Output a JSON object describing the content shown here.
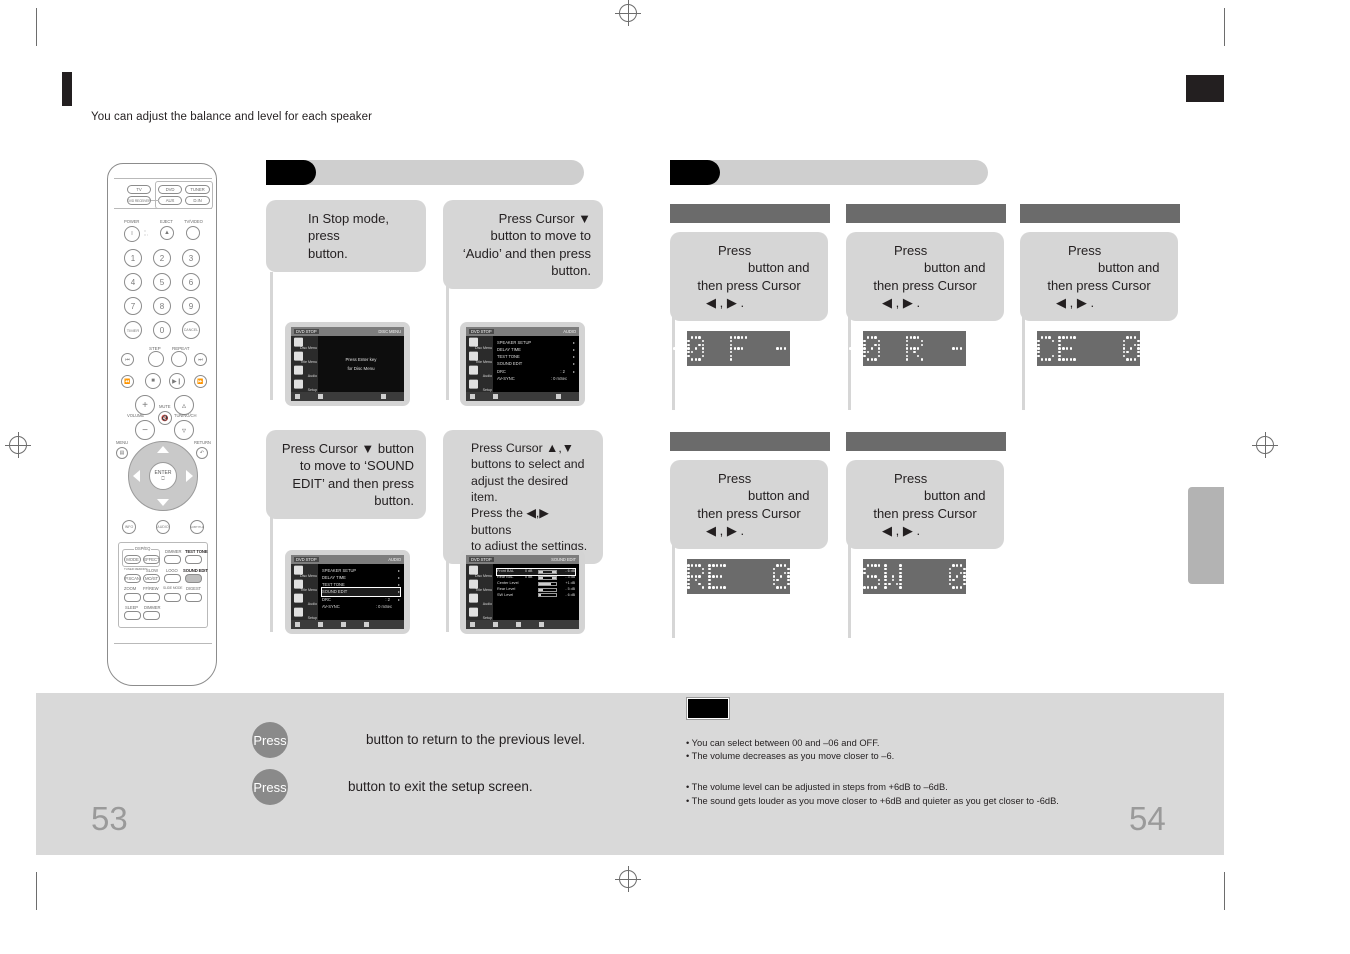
{
  "header": {
    "subtitle": "You can adjust the balance and level for each speaker"
  },
  "pages": {
    "left": "53",
    "right": "54"
  },
  "remote": {
    "source_buttons": [
      "TV",
      "DVD",
      "TUNER",
      "DVD RECEIVER",
      "AUX",
      "D.IN"
    ],
    "power_label": "POWER",
    "eject_label": "EJECT",
    "tvvideo_label": "TV/VIDEO",
    "numbers": [
      "1",
      "2",
      "3",
      "4",
      "5",
      "6",
      "7",
      "8",
      "9",
      "0"
    ],
    "timer_label": "TIMER",
    "cancel_label": "CANCEL",
    "step_label": "STEP",
    "repeat_label": "REPEAT",
    "volume_label": "VOLUME",
    "mute_label": "MUTE",
    "tuning_label": "TUNING/CH",
    "menu_label": "MENU",
    "return_label": "RETURN",
    "enter_label": "ENTER",
    "info_label": "INFO",
    "audio_label": "AUDIO",
    "sub_title_label": "SUBTITLE",
    "dsp_group_label": "DSP/EQ",
    "mode_label": "MODE",
    "effect_label": "EFFECT",
    "dimmer_big_label": "DIMMER",
    "test_tone_label": "TEST TONE",
    "tuner_memory_label": "TUNER MEMORY",
    "slow_label": "SLOW",
    "logo_label": "LOGO",
    "sound_edit_label": "SOUND EDIT",
    "pscan_label": "P.SCAN",
    "movst_label": "MO/ST",
    "zoom_label": "ZOOM",
    "ffrew_label": "FF/REW",
    "slide_mode_label": "SLIDE MODE",
    "digest_label": "DIGEST",
    "sleep_label": "SLEEP",
    "dimmer_label": "DIMMER"
  },
  "left_column": {
    "steps": [
      {
        "lines": [
          "In Stop mode,",
          "press",
          "button."
        ],
        "align": "left"
      },
      {
        "lines": [
          "Press Cursor ▼",
          "button to move to",
          "‘Audio’ and then press",
          "button."
        ],
        "align": "right"
      },
      {
        "lines": [
          "Press Cursor ▼ button",
          "to move to ‘SOUND",
          "EDIT’ and then press",
          "button."
        ],
        "align": "right"
      },
      {
        "lines": [
          "Press Cursor  ▲,▼",
          "buttons to select and",
          "adjust the desired item.",
          "Press the  ◀,▶  buttons",
          "to adjust the settings."
        ],
        "align": "left"
      }
    ],
    "screens": [
      {
        "topbar_left": "DVD  STOP",
        "topbar_right": "DISC MENU",
        "side_items": [
          "Disc Menu",
          "Title Menu",
          "Audio",
          "Setup"
        ],
        "center_lines": [
          "Press Enter key",
          "for Disc Menu"
        ],
        "rows": []
      },
      {
        "topbar_left": "DVD  STOP",
        "topbar_right": "AUDIO",
        "side_items": [
          "Disc Menu",
          "Title Menu",
          "Audio",
          "Setup"
        ],
        "center_lines": [],
        "rows": [
          {
            "label": "SPEAKER SETUP",
            "value": "",
            "arrow": "▸",
            "highlight": false
          },
          {
            "label": "DELAY TIME",
            "value": "",
            "arrow": "▸",
            "highlight": false
          },
          {
            "label": "TEST TONE",
            "value": "",
            "arrow": "▸",
            "highlight": false
          },
          {
            "label": "SOUND EDIT",
            "value": "",
            "arrow": "▸",
            "highlight": false
          },
          {
            "label": "DRC",
            "value": ": 2",
            "arrow": "▸",
            "highlight": false
          },
          {
            "label": "AV-SYNC",
            "value": ": 0 mSec",
            "arrow": "",
            "highlight": false
          }
        ]
      },
      {
        "topbar_left": "DVD  STOP",
        "topbar_right": "AUDIO",
        "side_items": [
          "Disc Menu",
          "Title Menu",
          "Audio",
          "Setup"
        ],
        "center_lines": [],
        "rows": [
          {
            "label": "SPEAKER SETUP",
            "value": "",
            "arrow": "▸",
            "highlight": false
          },
          {
            "label": "DELAY TIME",
            "value": "",
            "arrow": "▸",
            "highlight": false
          },
          {
            "label": "TEST TONE",
            "value": "",
            "arrow": "▸",
            "highlight": false
          },
          {
            "label": "SOUND EDIT",
            "value": "",
            "arrow": "▸",
            "highlight": true
          },
          {
            "label": "DRC",
            "value": ": 2",
            "arrow": "▸",
            "highlight": false
          },
          {
            "label": "AV-SYNC",
            "value": ": 0 mSec",
            "arrow": "",
            "highlight": false
          }
        ]
      },
      {
        "topbar_left": "DVD  STOP",
        "topbar_right": "SOUND EDIT",
        "side_items": [
          "Disc Menu",
          "Title Menu",
          "Audio",
          "Setup"
        ],
        "center_lines": [],
        "bars": [
          {
            "label": "Front BAL",
            "value": "0 dB",
            "db": "- 6 dB",
            "fill_left": 0,
            "fill_width": 100,
            "style": "ends",
            "highlight": true
          },
          {
            "label": "Rear BAL",
            "value": "0 dB",
            "db": "- 3 dB",
            "fill_left": 0,
            "fill_width": 100,
            "style": "ends",
            "highlight": false
          },
          {
            "label": "Center Level",
            "value": "",
            "db": "+1 dB",
            "fill_left": 0,
            "fill_width": 72,
            "style": "fill",
            "highlight": false
          },
          {
            "label": "Rear Level",
            "value": "",
            "db": "- 5 dB",
            "fill_left": 0,
            "fill_width": 22,
            "style": "fill",
            "highlight": false
          },
          {
            "label": "SW Level",
            "value": "",
            "db": "- 6 dB",
            "fill_left": 0,
            "fill_width": 14,
            "style": "fill",
            "highlight": false
          }
        ],
        "rows": []
      }
    ]
  },
  "right_column": {
    "steps": [
      {
        "lines": [
          "Press",
          "button and",
          "then press Cursor",
          "◀ , ▶ ."
        ],
        "display": "-0 F -0",
        "glyphs": [
          "dash",
          "zero",
          "space",
          "F",
          "dash",
          "zero"
        ]
      },
      {
        "lines": [
          "Press",
          "button and",
          "then press Cursor",
          "◀ , ▶ ."
        ],
        "display": "-0 R -0",
        "glyphs": [
          "dash",
          "zero",
          "space",
          "R",
          "dash",
          "zero"
        ]
      },
      {
        "lines": [
          "Press",
          "button and",
          "then press Cursor",
          "◀ , ▶ ."
        ],
        "display": "CE  0",
        "glyphs": [
          "C",
          "E",
          "space",
          "space",
          "zero"
        ]
      },
      {
        "lines": [
          "Press",
          "button and",
          "then press Cursor",
          "◀ , ▶ ."
        ],
        "display": "RE  0",
        "glyphs": [
          "R",
          "E",
          "space",
          "space",
          "zero"
        ]
      },
      {
        "lines": [
          "Press",
          "button and",
          "then press Cursor",
          "◀ , ▶ ."
        ],
        "display": "SW  0",
        "glyphs": [
          "S",
          "W",
          "space",
          "space",
          "zero"
        ]
      }
    ]
  },
  "footer": {
    "left_items": [
      {
        "badge": "Press",
        "text": "button to return to the previous level."
      },
      {
        "badge": "Press",
        "text": "button to exit the setup screen."
      }
    ],
    "note_lines_group1": [
      "• You can select between 00 and –06 and OFF.",
      "• The volume decreases as you move closer to –6."
    ],
    "note_lines_group2": [
      "• The volume level can be adjusted in steps from +6dB to –6dB.",
      "• The sound gets louder as you move closer to +6dB and quieter as you get closer to -6dB."
    ]
  }
}
